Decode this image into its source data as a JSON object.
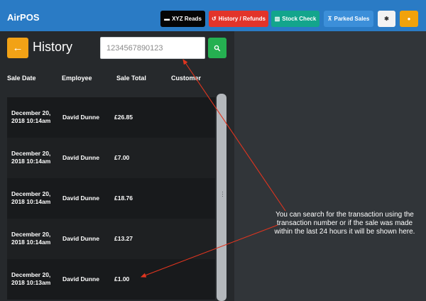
{
  "app": {
    "brand": "AirPOS"
  },
  "toolbar": {
    "xyz": {
      "icon": "card-icon",
      "label": "XYZ Reads"
    },
    "history": {
      "icon": "history-icon",
      "label": "History / Refunds"
    },
    "stock": {
      "icon": "barcode-icon",
      "label": "Stock Check"
    },
    "parked": {
      "icon": "parked-icon",
      "label": "Parked Sales"
    },
    "settings": {
      "icon": "gear-icon"
    },
    "user": {
      "icon": "user-icon"
    }
  },
  "history": {
    "title": "History",
    "search_value": "1234567890123",
    "columns": [
      "Sale Date",
      "Employee",
      "Sale Total",
      "Customer"
    ],
    "rows": [
      {
        "date": "December 20, 2018 10:14am",
        "employee": "David Dunne",
        "total": "£26.85",
        "customer": ""
      },
      {
        "date": "December 20, 2018 10:14am",
        "employee": "David Dunne",
        "total": "£7.00",
        "customer": ""
      },
      {
        "date": "December 20, 2018 10:14am",
        "employee": "David Dunne",
        "total": "£18.76",
        "customer": ""
      },
      {
        "date": "December 20, 2018 10:14am",
        "employee": "David Dunne",
        "total": "£13.27",
        "customer": ""
      },
      {
        "date": "December 20, 2018 10:13am",
        "employee": "David Dunne",
        "total": "£1.00",
        "customer": ""
      }
    ]
  },
  "annotation": {
    "text": "You can search for the transaction using the transaction number or if the sale was made within the last 24 hours it will be shown here.",
    "color": "#e1351f"
  },
  "colors": {
    "topbar": "#2a7bc5",
    "back_button": "#f2a216",
    "search_button": "#25b051"
  }
}
